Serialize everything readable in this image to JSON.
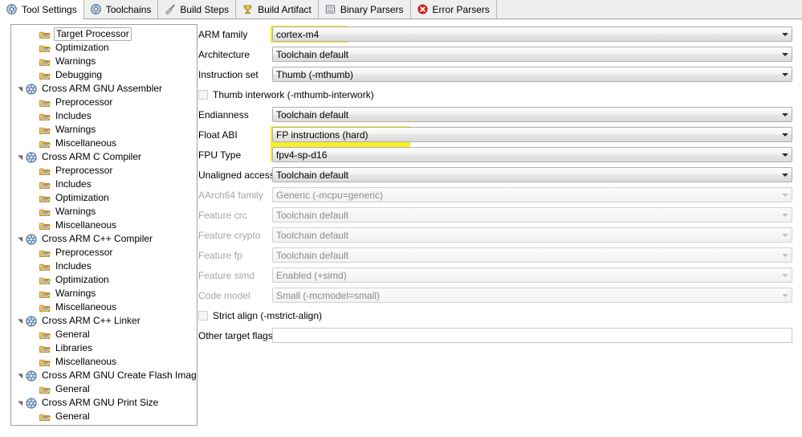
{
  "tabs": [
    {
      "label": "Tool Settings",
      "icon": "tool-settings-icon",
      "active": true
    },
    {
      "label": "Toolchains",
      "icon": "toolchains-icon",
      "active": false
    },
    {
      "label": "Build Steps",
      "icon": "build-steps-icon",
      "active": false
    },
    {
      "label": "Build Artifact",
      "icon": "build-artifact-icon",
      "active": false
    },
    {
      "label": "Binary Parsers",
      "icon": "binary-parsers-icon",
      "active": false
    },
    {
      "label": "Error Parsers",
      "icon": "error-parsers-icon",
      "active": false
    }
  ],
  "tree": [
    {
      "label": "Target Processor",
      "depth": 1,
      "type": "page",
      "twisty": "none",
      "selected": true
    },
    {
      "label": "Optimization",
      "depth": 1,
      "type": "page",
      "twisty": "none",
      "selected": false
    },
    {
      "label": "Warnings",
      "depth": 1,
      "type": "page",
      "twisty": "none",
      "selected": false
    },
    {
      "label": "Debugging",
      "depth": 1,
      "type": "page",
      "twisty": "none",
      "selected": false
    },
    {
      "label": "Cross ARM GNU Assembler",
      "depth": 0,
      "type": "tool",
      "twisty": "expanded",
      "selected": false
    },
    {
      "label": "Preprocessor",
      "depth": 1,
      "type": "page",
      "twisty": "none",
      "selected": false
    },
    {
      "label": "Includes",
      "depth": 1,
      "type": "page",
      "twisty": "none",
      "selected": false
    },
    {
      "label": "Warnings",
      "depth": 1,
      "type": "page",
      "twisty": "none",
      "selected": false
    },
    {
      "label": "Miscellaneous",
      "depth": 1,
      "type": "page",
      "twisty": "none",
      "selected": false
    },
    {
      "label": "Cross ARM C Compiler",
      "depth": 0,
      "type": "tool",
      "twisty": "expanded",
      "selected": false
    },
    {
      "label": "Preprocessor",
      "depth": 1,
      "type": "page",
      "twisty": "none",
      "selected": false
    },
    {
      "label": "Includes",
      "depth": 1,
      "type": "page",
      "twisty": "none",
      "selected": false
    },
    {
      "label": "Optimization",
      "depth": 1,
      "type": "page",
      "twisty": "none",
      "selected": false
    },
    {
      "label": "Warnings",
      "depth": 1,
      "type": "page",
      "twisty": "none",
      "selected": false
    },
    {
      "label": "Miscellaneous",
      "depth": 1,
      "type": "page",
      "twisty": "none",
      "selected": false
    },
    {
      "label": "Cross ARM C++ Compiler",
      "depth": 0,
      "type": "tool",
      "twisty": "expanded",
      "selected": false
    },
    {
      "label": "Preprocessor",
      "depth": 1,
      "type": "page",
      "twisty": "none",
      "selected": false
    },
    {
      "label": "Includes",
      "depth": 1,
      "type": "page",
      "twisty": "none",
      "selected": false
    },
    {
      "label": "Optimization",
      "depth": 1,
      "type": "page",
      "twisty": "none",
      "selected": false
    },
    {
      "label": "Warnings",
      "depth": 1,
      "type": "page",
      "twisty": "none",
      "selected": false
    },
    {
      "label": "Miscellaneous",
      "depth": 1,
      "type": "page",
      "twisty": "none",
      "selected": false
    },
    {
      "label": "Cross ARM C++ Linker",
      "depth": 0,
      "type": "tool",
      "twisty": "expanded",
      "selected": false
    },
    {
      "label": "General",
      "depth": 1,
      "type": "page",
      "twisty": "none",
      "selected": false
    },
    {
      "label": "Libraries",
      "depth": 1,
      "type": "page",
      "twisty": "none",
      "selected": false
    },
    {
      "label": "Miscellaneous",
      "depth": 1,
      "type": "page",
      "twisty": "none",
      "selected": false
    },
    {
      "label": "Cross ARM GNU Create Flash Image",
      "depth": 0,
      "type": "tool",
      "twisty": "expanded",
      "selected": false
    },
    {
      "label": "General",
      "depth": 1,
      "type": "page",
      "twisty": "none",
      "selected": false
    },
    {
      "label": "Cross ARM GNU Print Size",
      "depth": 0,
      "type": "tool",
      "twisty": "expanded",
      "selected": false
    },
    {
      "label": "General",
      "depth": 1,
      "type": "page",
      "twisty": "none",
      "selected": false
    }
  ],
  "form": {
    "fields": [
      {
        "name": "arm-family",
        "label": "ARM family",
        "value": "cortex-m4",
        "kind": "combo",
        "enabled": true,
        "highlight": true
      },
      {
        "name": "architecture",
        "label": "Architecture",
        "value": "Toolchain default",
        "kind": "combo",
        "enabled": true,
        "highlight": false
      },
      {
        "name": "instruction-set",
        "label": "Instruction set",
        "value": "Thumb (-mthumb)",
        "kind": "combo",
        "enabled": true,
        "highlight": false
      },
      {
        "name": "thumb-interwork",
        "label": "Thumb interwork (-mthumb-interwork)",
        "kind": "checkbox",
        "checked": false,
        "enabled": true
      },
      {
        "name": "endianness",
        "label": "Endianness",
        "value": "Toolchain default",
        "kind": "combo",
        "enabled": true,
        "highlight": false
      },
      {
        "name": "float-abi",
        "label": "Float ABI",
        "value": "FP instructions (hard)",
        "kind": "combo",
        "enabled": true,
        "highlight": true
      },
      {
        "name": "fpu-type",
        "label": "FPU Type",
        "value": "fpv4-sp-d16",
        "kind": "combo",
        "enabled": true,
        "highlight": true
      },
      {
        "name": "unaligned-access",
        "label": "Unaligned access",
        "value": "Toolchain default",
        "kind": "combo",
        "enabled": true,
        "highlight": false
      },
      {
        "name": "aarch64-family",
        "label": "AArch64 family",
        "value": "Generic (-mcpu=generic)",
        "kind": "combo",
        "enabled": false,
        "highlight": false
      },
      {
        "name": "feature-crc",
        "label": "Feature crc",
        "value": "Toolchain default",
        "kind": "combo",
        "enabled": false,
        "highlight": false
      },
      {
        "name": "feature-crypto",
        "label": "Feature crypto",
        "value": "Toolchain default",
        "kind": "combo",
        "enabled": false,
        "highlight": false
      },
      {
        "name": "feature-fp",
        "label": "Feature fp",
        "value": "Toolchain default",
        "kind": "combo",
        "enabled": false,
        "highlight": false
      },
      {
        "name": "feature-simd",
        "label": "Feature simd",
        "value": "Enabled (+simd)",
        "kind": "combo",
        "enabled": false,
        "highlight": false
      },
      {
        "name": "code-model",
        "label": "Code model",
        "value": "Small (-mcmodel=small)",
        "kind": "combo",
        "enabled": false,
        "highlight": false
      },
      {
        "name": "strict-align",
        "label": "Strict align (-mstrict-align)",
        "kind": "checkbox",
        "checked": false,
        "enabled": true
      },
      {
        "name": "other-target-flags",
        "label": "Other target flags",
        "value": "",
        "kind": "text",
        "enabled": true
      }
    ]
  },
  "colors": {
    "highlight": "#f6ef28",
    "panel_border": "#a0a0a0",
    "tab_bar_bg": "#efefef",
    "disabled_text": "#8c8c8c"
  }
}
